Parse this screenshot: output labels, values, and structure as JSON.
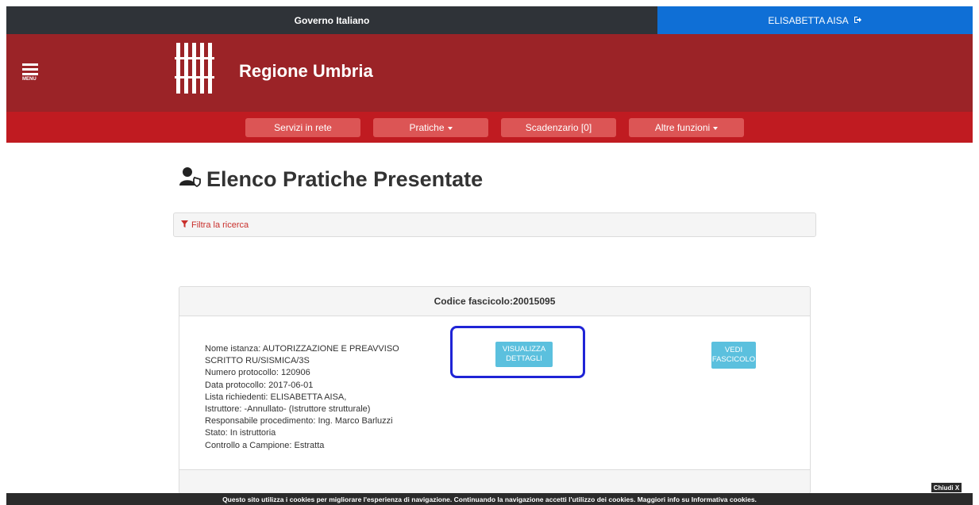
{
  "gov_bar": {
    "title": "Governo Italiano",
    "user_name": "ELISABETTA AISA",
    "logout_icon": "sign-out-icon",
    "user_bg": "#0f6fd6"
  },
  "header": {
    "menu_label": "MENU",
    "region_name": "Regione Umbria",
    "bg_color": "#9b2327"
  },
  "nav": {
    "bg_color": "#c01b21",
    "items": [
      {
        "label": "Servizi in rete",
        "dropdown": false
      },
      {
        "label": "Pratiche",
        "dropdown": true
      },
      {
        "label": "Scadenzario [0]",
        "dropdown": false
      },
      {
        "label": "Altre funzioni",
        "dropdown": true
      }
    ]
  },
  "page": {
    "title": "Elenco Pratiche Presentate",
    "title_icon": "user-shield-icon",
    "filter_label": "Filtra la ricerca",
    "filter_icon": "filter-icon"
  },
  "fascicolo": {
    "header": "Codice fascicolo:20015095",
    "lines": [
      "Nome istanza: AUTORIZZAZIONE E PREAVVISO",
      "SCRITTO RU/SISMICA/3S",
      "Numero protocollo: 120906",
      "Data protocollo: 2017-06-01",
      "Lista richiedenti: ELISABETTA AISA,",
      "Istruttore: -Annullato- (Istruttore strutturale)",
      "Responsabile procedimento: Ing. Marco Barluzzi",
      "Stato: In istruttoria",
      "Controllo a Campione: Estratta"
    ],
    "btn_details_line1": "VISUALIZZA",
    "btn_details_line2": "DETTAGLI",
    "btn_fascicolo_line1": "VEDI",
    "btn_fascicolo_line2": "FASCICOLO"
  },
  "cookie": {
    "text": "Questo sito utilizza i cookies per migliorare l'esperienza di navigazione. Continuando la navigazione accetti l'utilizzo dei cookies. Maggiori info su Informativa cookies.",
    "close_label": "Chiudi X"
  }
}
